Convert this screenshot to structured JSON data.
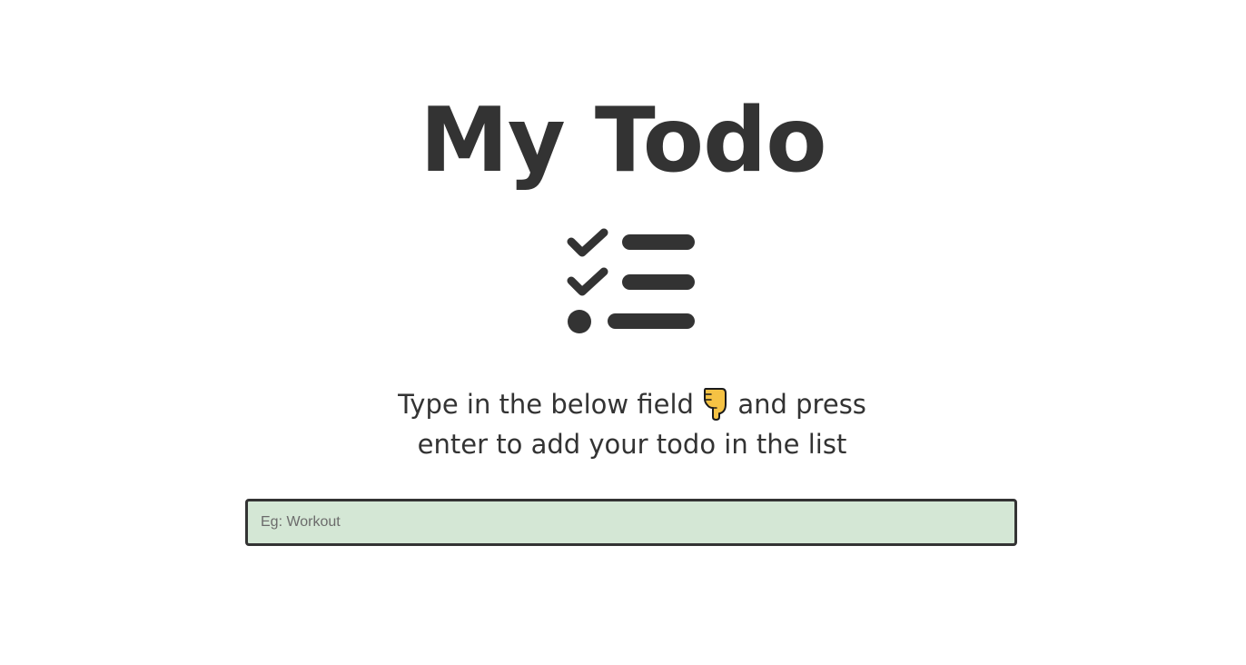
{
  "header": {
    "title": "My Todo",
    "icon": "checklist-icon"
  },
  "instructions": {
    "line1_before": "Type in the below field",
    "pointer_icon": "pointing-down-hand-icon",
    "line1_after": "and press",
    "line2": "enter to add your todo in the list"
  },
  "todo_input": {
    "placeholder": "Eg: Workout",
    "value": ""
  },
  "colors": {
    "text": "#333333",
    "input_background": "#d4e7d5",
    "input_border": "#333333",
    "hand_fill": "#f5c244"
  }
}
